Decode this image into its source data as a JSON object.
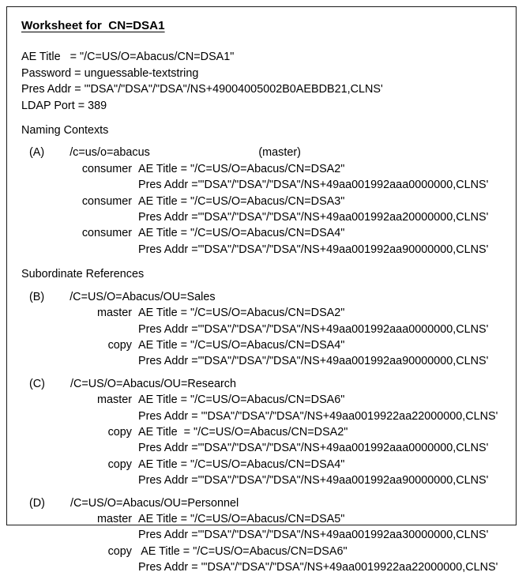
{
  "document": {
    "title": "Worksheet for  CN=DSA1",
    "header_fields": [
      {
        "label": "AE Title",
        "separator": "   = ",
        "value": "\"/C=US/O=Abacus/CN=DSA1\""
      },
      {
        "label": "Password",
        "separator": " = ",
        "value": "unguessable-textstring"
      },
      {
        "label": "Pres Addr",
        "separator": " = ",
        "value": "'\"DSA\"/\"DSA\"/\"DSA\"/NS+49004005002B0AEBDB21,CLNS'"
      },
      {
        "label": "LDAP Port",
        "separator": " = ",
        "value": "389"
      }
    ],
    "sections": [
      {
        "heading": "Naming Contexts",
        "groups": [
          {
            "ref": "(A)",
            "dn": "/c=us/o=abacus",
            "annotation": "(master)",
            "entries": [
              {
                "role": "consumer",
                "ae_title_label": "AE Title = ",
                "ae_title_value": "\"/C=US/O=Abacus/CN=DSA2\"",
                "pres_addr_label": "Pres Addr =",
                "pres_addr_value": "'\"DSA\"/\"DSA\"/\"DSA\"/NS+49aa001992aaa0000000,CLNS'"
              },
              {
                "role": "consumer",
                "ae_title_label": "AE Title = ",
                "ae_title_value": "\"/C=US/O=Abacus/CN=DSA3\"",
                "pres_addr_label": "Pres Addr =",
                "pres_addr_value": "'\"DSA\"/\"DSA\"/\"DSA\"/NS+49aa001992aa20000000,CLNS'"
              },
              {
                "role": "consumer",
                "ae_title_label": "AE Title = ",
                "ae_title_value": "\"/C=US/O=Abacus/CN=DSA4\"",
                "pres_addr_label": "Pres Addr =",
                "pres_addr_value": "'\"DSA\"/\"DSA\"/\"DSA\"/NS+49aa001992aa90000000,CLNS'"
              }
            ]
          }
        ]
      },
      {
        "heading": "Subordinate References",
        "groups": [
          {
            "ref": "(B)",
            "dn": "/C=US/O=Abacus/OU=Sales",
            "annotation": "",
            "entries": [
              {
                "role": "master",
                "ae_title_label": "AE Title = ",
                "ae_title_value": "\"/C=US/O=Abacus/CN=DSA2\"",
                "pres_addr_label": "Pres Addr =",
                "pres_addr_value": "'\"DSA\"/\"DSA\"/\"DSA\"/NS+49aa001992aaa0000000,CLNS'"
              },
              {
                "role": "copy",
                "ae_title_label": "AE Title = ",
                "ae_title_value": "\"/C=US/O=Abacus/CN=DSA4\"",
                "pres_addr_label": "Pres Addr =",
                "pres_addr_value": "'\"DSA\"/\"DSA\"/\"DSA\"/NS+49aa001992aa90000000,CLNS'"
              }
            ]
          },
          {
            "ref": "(C)",
            "dn": "/C=US/O=Abacus/OU=Research",
            "annotation": "",
            "entries": [
              {
                "role": "master",
                "ae_title_label": "AE Title = ",
                "ae_title_value": "\"/C=US/O=Abacus/CN=DSA6\"",
                "pres_addr_label": "Pres Addr = ",
                "pres_addr_value": "'\"DSA\"/\"DSA\"/\"DSA\"/NS+49aa0019922aa22000000,CLNS'"
              },
              {
                "role": "copy",
                "ae_title_label": "AE Title  = ",
                "ae_title_value": "\"/C=US/O=Abacus/CN=DSA2\"",
                "pres_addr_label": "Pres Addr =",
                "pres_addr_value": "'\"DSA\"/\"DSA\"/\"DSA\"/NS+49aa001992aaa0000000,CLNS'"
              },
              {
                "role": "copy",
                "ae_title_label": "AE Title = ",
                "ae_title_value": "\"/C=US/O=Abacus/CN=DSA4\"",
                "pres_addr_label": "Pres Addr =",
                "pres_addr_value": "'\"DSA\"/\"DSA\"/\"DSA\"/NS+49aa001992aa90000000,CLNS'"
              }
            ]
          },
          {
            "ref": "(D)",
            "dn": "/C=US/O=Abacus/OU=Personnel",
            "annotation": "",
            "entries": [
              {
                "role": "master",
                "ae_title_label": "AE Title = ",
                "ae_title_value": "\"/C=US/O=Abacus/CN=DSA5\"",
                "pres_addr_label": "Pres Addr =",
                "pres_addr_value": "'\"DSA\"/\"DSA\"/\"DSA\"/NS+49aa001992aa30000000,CLNS'"
              },
              {
                "role": "copy",
                "ae_title_label": " AE Title = ",
                "ae_title_value": "\"/C=US/O=Abacus/CN=DSA6\"",
                "pres_addr_label": "Pres Addr = ",
                "pres_addr_value": "'\"DSA\"/\"DSA\"/\"DSA\"/NS+49aa0019922aa22000000,CLNS'"
              }
            ]
          }
        ]
      }
    ]
  },
  "colors": {
    "border": "#1a1a1a",
    "text": "#000000",
    "background": "#ffffff"
  }
}
